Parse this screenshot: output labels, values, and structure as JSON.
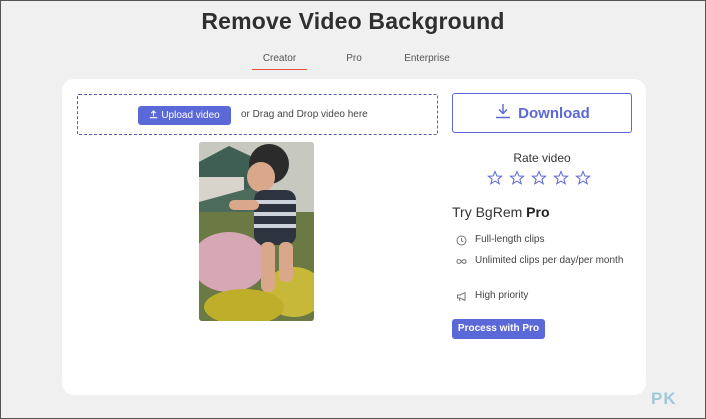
{
  "page": {
    "title": "Remove Video Background"
  },
  "tabs": [
    {
      "label": "Creator",
      "active": true
    },
    {
      "label": "Pro",
      "active": false
    },
    {
      "label": "Enterprise",
      "active": false
    }
  ],
  "upload": {
    "button_label": "Upload video",
    "drop_text": "or Drag and Drop video here"
  },
  "download": {
    "label": "Download"
  },
  "rating": {
    "label": "Rate video",
    "stars": 5,
    "selected": 0
  },
  "pro_offer": {
    "title_prefix": "Try BgRem",
    "title_bold": "Pro",
    "features": [
      {
        "icon": "clock-icon",
        "text": "Full-length clips"
      },
      {
        "icon": "infinity-icon",
        "text": "Unlimited clips per day/per month"
      },
      {
        "icon": "megaphone-icon",
        "text": "High priority"
      }
    ],
    "button_label": "Process with Pro"
  },
  "watermark": {
    "text": "PK"
  },
  "colors": {
    "accent": "#5b68d8",
    "tab_underline": "#e0533f",
    "background": "#f0f0f0",
    "card": "#ffffff"
  }
}
